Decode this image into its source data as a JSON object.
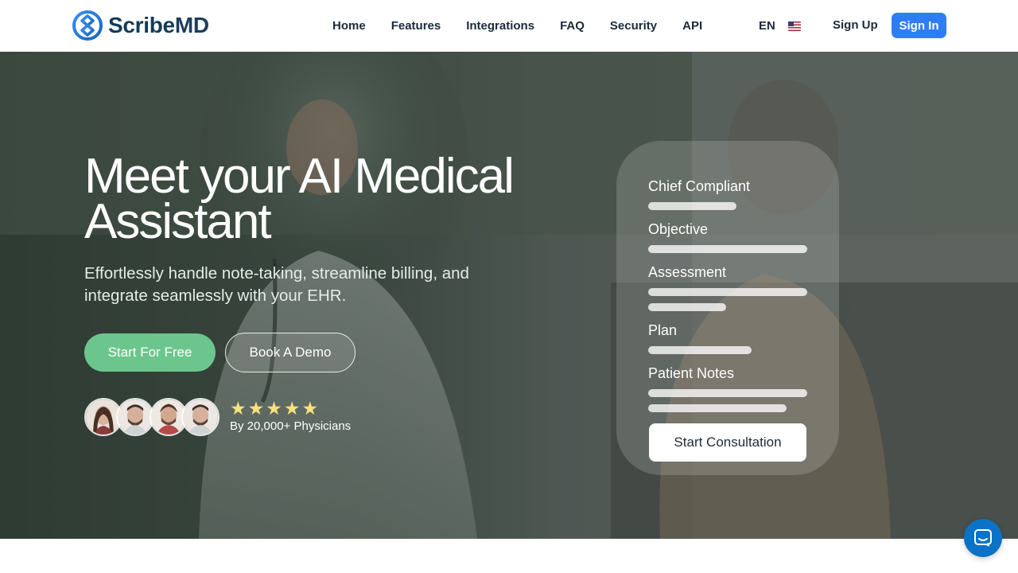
{
  "brand": {
    "name_a": "Scribe",
    "name_b": "MD",
    "color": "#1c3d5e",
    "accent": "#2f7df6"
  },
  "nav": {
    "links": [
      "Home",
      "Features",
      "Integrations",
      "FAQ",
      "Security",
      "API"
    ],
    "lang": "EN",
    "flag_icon": "us-flag-icon",
    "signup": "Sign Up",
    "signin": "Sign In"
  },
  "hero": {
    "title": "Meet your AI Medical Assistant",
    "subtitle": "Effortlessly handle note-taking, streamline billing, and integrate seamlessly with your EHR.",
    "primary_cta": "Start For Free",
    "secondary_cta": "Book A Demo",
    "rating_stars": 5,
    "social_proof": "By 20,000+ Physicians",
    "cta_color": "#6cc58d"
  },
  "card": {
    "sections": [
      {
        "label": "Chief Compliant"
      },
      {
        "label": "Objective"
      },
      {
        "label": "Assessment"
      },
      {
        "label": "Plan"
      },
      {
        "label": "Patient Notes"
      }
    ],
    "button": "Start Consultation"
  },
  "chat": {
    "icon": "chat-bubble-icon"
  }
}
